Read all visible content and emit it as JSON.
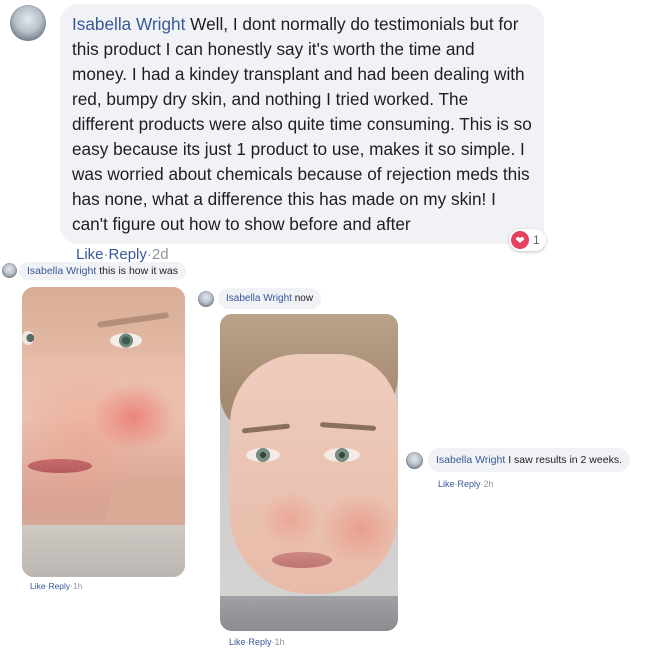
{
  "main_comment": {
    "author": "Isabella Wright",
    "text": "Well, I dont normally do testimonials but for this product I can honestly say it's worth the time and money. I had a kindey transplant and had been dealing with red, bumpy dry skin, and nothing I tried worked. The different products were also quite time consuming. This is so easy because its just 1 product to use, makes it so simple. I was worried about chemicals because of rejection meds this has none, what a difference this has made on my skin! I can't figure out how to show before and after",
    "reaction_count": "1",
    "reaction_icon": "heart-icon",
    "like": "Like",
    "reply": "Reply",
    "time": "2d"
  },
  "reply_before": {
    "author": "Isabella Wright",
    "text": "this is how it was",
    "like": "Like",
    "reply": "Reply",
    "time": "1h"
  },
  "reply_after": {
    "author": "Isabella Wright",
    "text": "now",
    "like": "Like",
    "reply": "Reply",
    "time": "1h"
  },
  "reply_results": {
    "author": "Isabella Wright",
    "text": "I saw results in 2 weeks.",
    "like": "Like",
    "reply": "Reply",
    "time": "2h"
  },
  "separator": "·",
  "colors": {
    "link": "#385898",
    "bubble": "#f0f2f5",
    "meta": "#90949c",
    "heart": "#e4405f"
  }
}
